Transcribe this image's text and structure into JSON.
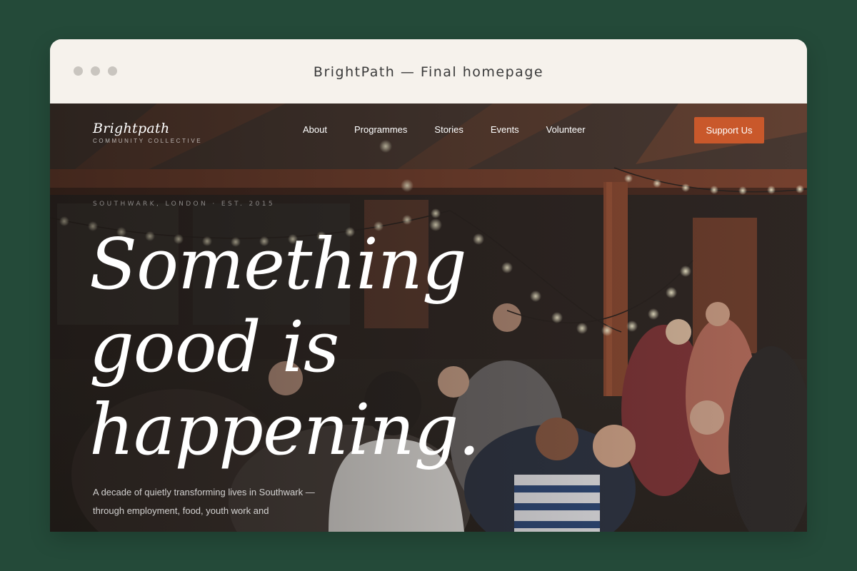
{
  "window": {
    "title": "BrightPath — Final homepage"
  },
  "site": {
    "brand": {
      "name": "Brightpath",
      "tagline": "COMMUNITY COLLECTIVE"
    },
    "nav": [
      {
        "label": "About"
      },
      {
        "label": "Programmes"
      },
      {
        "label": "Stories"
      },
      {
        "label": "Events"
      },
      {
        "label": "Volunteer"
      }
    ],
    "cta": {
      "label": "Support Us"
    },
    "hero": {
      "eyebrow": "SOUTHWARK, LONDON · EST. 2015",
      "headline_line1": "Something",
      "headline_line2": "good is",
      "headline_line3": "happening.",
      "lede": "A decade of quietly transforming lives in Southwark — through employment, food, youth work and"
    }
  },
  "colors": {
    "page_bg": "#244a39",
    "accent": "#c9582b",
    "chrome_bg": "#f6f2ec"
  },
  "icons": {
    "window_controls": [
      "window-dot-icon",
      "window-dot-icon",
      "window-dot-icon"
    ]
  }
}
